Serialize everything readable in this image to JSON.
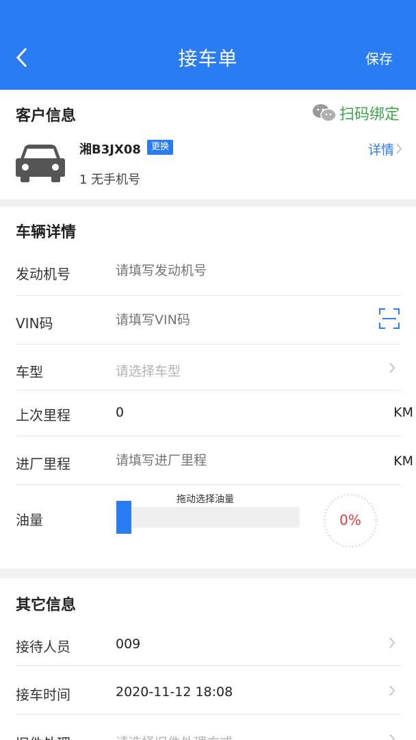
{
  "header": {
    "title": "接车单",
    "save_label": "保存"
  },
  "customer": {
    "section_title": "客户信息",
    "scan_bind_label": "扫码绑定",
    "plate": "湘B3JX08",
    "change_label": "更换",
    "phone": "1 无手机号",
    "detail_label": "详情"
  },
  "vehicle": {
    "section_title": "车辆详情",
    "engine": {
      "label": "发动机号",
      "placeholder": "请填写发动机号"
    },
    "vin": {
      "label": "VIN码",
      "placeholder": "请填写VIN码"
    },
    "model": {
      "label": "车型",
      "placeholder": "请选择车型"
    },
    "last_mileage": {
      "label": "上次里程",
      "value": "0",
      "unit": "KM"
    },
    "entry_mileage": {
      "label": "进厂里程",
      "placeholder": "请填写进厂里程",
      "unit": "KM"
    },
    "fuel": {
      "label": "油量",
      "hint": "拖动选择油量",
      "percent_text": "0%",
      "level": 0
    }
  },
  "other": {
    "section_title": "其它信息",
    "receptionist": {
      "label": "接待人员",
      "value": "009"
    },
    "pickup_time": {
      "label": "接车时间",
      "value": "2020-11-12 18:08"
    },
    "old_parts": {
      "label": "旧件处理",
      "placeholder": "请选择旧件处理方式"
    }
  },
  "colors": {
    "primary": "#2a7cf3",
    "wechat_green": "#3aa84a",
    "fuel_red": "#e23b3b"
  }
}
